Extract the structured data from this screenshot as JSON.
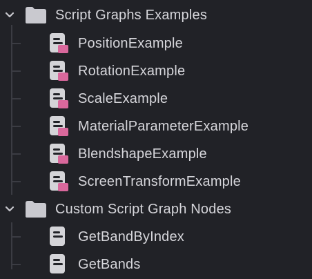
{
  "tree": {
    "folders": [
      {
        "label": "Script Graphs Examples",
        "expanded": true,
        "icon": "folder-icon",
        "children": [
          {
            "label": "PositionExample",
            "icon": "script-graph-icon",
            "badge_color": "#d9689c"
          },
          {
            "label": "RotationExample",
            "icon": "script-graph-icon",
            "badge_color": "#d9689c"
          },
          {
            "label": "ScaleExample",
            "icon": "script-graph-icon",
            "badge_color": "#d9689c"
          },
          {
            "label": "MaterialParameterExample",
            "icon": "script-graph-icon",
            "badge_color": "#d9689c"
          },
          {
            "label": "BlendshapeExample",
            "icon": "script-graph-icon",
            "badge_color": "#d9689c"
          },
          {
            "label": "ScreenTransformExample",
            "icon": "script-graph-icon",
            "badge_color": "#d9689c"
          }
        ]
      },
      {
        "label": "Custom Script Graph Nodes",
        "expanded": true,
        "icon": "folder-icon",
        "children": [
          {
            "label": "GetBandByIndex",
            "icon": "script-node-icon"
          },
          {
            "label": "GetBands",
            "icon": "script-node-icon"
          }
        ]
      }
    ]
  },
  "colors": {
    "background": "#212227",
    "text": "#d6d6db",
    "folder": "#c9c9cf",
    "file_icon": "#d4d4d8",
    "badge": "#d9689c",
    "guide": "#3b3c43"
  }
}
